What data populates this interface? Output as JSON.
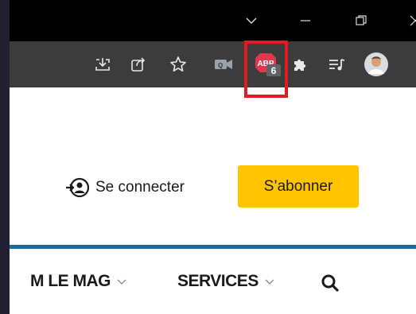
{
  "window": {
    "controls": [
      {
        "name": "tab-list-dropdown",
        "icon": "chevron-down-icon"
      },
      {
        "name": "minimize",
        "icon": "minimize-icon"
      },
      {
        "name": "restore",
        "icon": "restore-icon"
      },
      {
        "name": "close",
        "icon": "close-icon"
      }
    ]
  },
  "toolbar": {
    "extensions": {
      "abp_label": "ABP",
      "abp_badge": "6"
    }
  },
  "page": {
    "login_label": "Se connecter",
    "subscribe_label": "S’abonner",
    "nav": {
      "items": [
        {
          "label": "M LE MAG"
        },
        {
          "label": "SERVICES"
        }
      ]
    }
  },
  "colors": {
    "accent_yellow": "#ffc400",
    "rule_blue": "#1b6aa0",
    "abp_red": "#e2384f",
    "highlight_red": "#e01b22"
  }
}
